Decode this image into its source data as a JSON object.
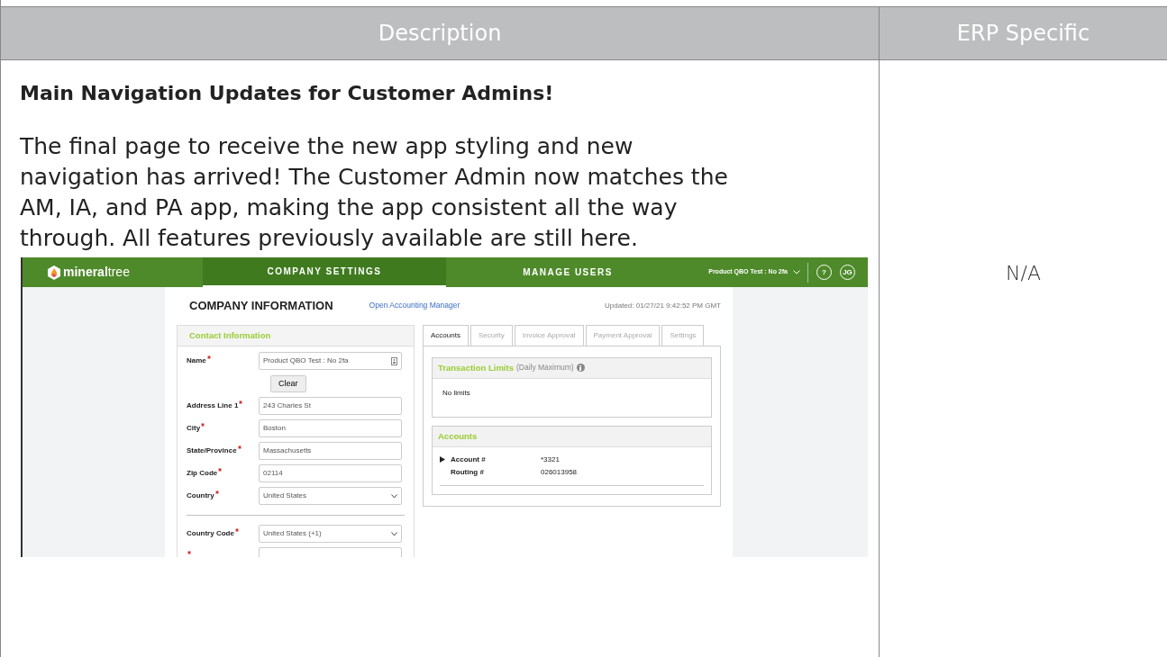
{
  "table": {
    "columns": [
      {
        "label": "Description"
      },
      {
        "label": "ERP Specific"
      }
    ],
    "rows": [
      {
        "title": "Main Navigation Updates for Customer Admins!",
        "body": "The final page to receive the new app styling and new navigation has arrived! The Customer Admin now matches the AM, IA, and PA app, making the app consistent all the way through. All features previously available are still here.",
        "erp": "N/A",
        "screenshot": {
          "nav": {
            "logo": "**mineral**tree",
            "tabs": [
              {
                "label": "COMPANY SETTINGS",
                "selected": true
              },
              {
                "label": "MANAGE USERS",
                "selected": false
              }
            ],
            "company": "Product QBO Test : No 2fa",
            "help": "?",
            "avatar": "JG"
          },
          "title": "COMPANY INFORMATION",
          "link": "Open Accounting Manager",
          "updated": "Updated: 01/27/21 9:42:52 PM GMT",
          "contact": {
            "heading": "Contact Information",
            "clear_button": "Clear",
            "fields": [
              {
                "label": "Name",
                "value": "Product QBO Test : No 2fa",
                "kind": "text-card",
                "required": true
              },
              {
                "label": "Address Line 1",
                "value": "243 Charles St",
                "kind": "text",
                "required": true
              },
              {
                "label": "City",
                "value": "Boston",
                "kind": "text",
                "required": true
              },
              {
                "label": "State/Province",
                "value": "Massachusetts",
                "kind": "text",
                "required": true
              },
              {
                "label": "Zip Code",
                "value": "02114",
                "kind": "text",
                "required": true
              },
              {
                "label": "Country",
                "value": "United States",
                "kind": "select",
                "required": true
              },
              {
                "kind": "divider"
              },
              {
                "label": "Country Code",
                "value": "United States (+1)",
                "kind": "select",
                "required": true
              },
              {
                "kind": "text",
                "required": true
              }
            ]
          },
          "tabs": [
            {
              "label": "Accounts",
              "selected": true
            },
            {
              "label": "Security",
              "selected": false
            },
            {
              "label": "Invoice Approval",
              "selected": false
            },
            {
              "label": "Payment Approval",
              "selected": false
            },
            {
              "label": "Settings",
              "selected": false
            }
          ],
          "limits": {
            "heading": "Transaction Limits",
            "note": "(Daily Maximum)",
            "body": "No limits"
          },
          "accounts": {
            "heading": "Accounts",
            "expanded": false,
            "rows": [
              {
                "label": "Account #",
                "value": "*3321"
              },
              {
                "label": "Routing #",
                "value": "026013958"
              }
            ]
          }
        }
      }
    ]
  }
}
